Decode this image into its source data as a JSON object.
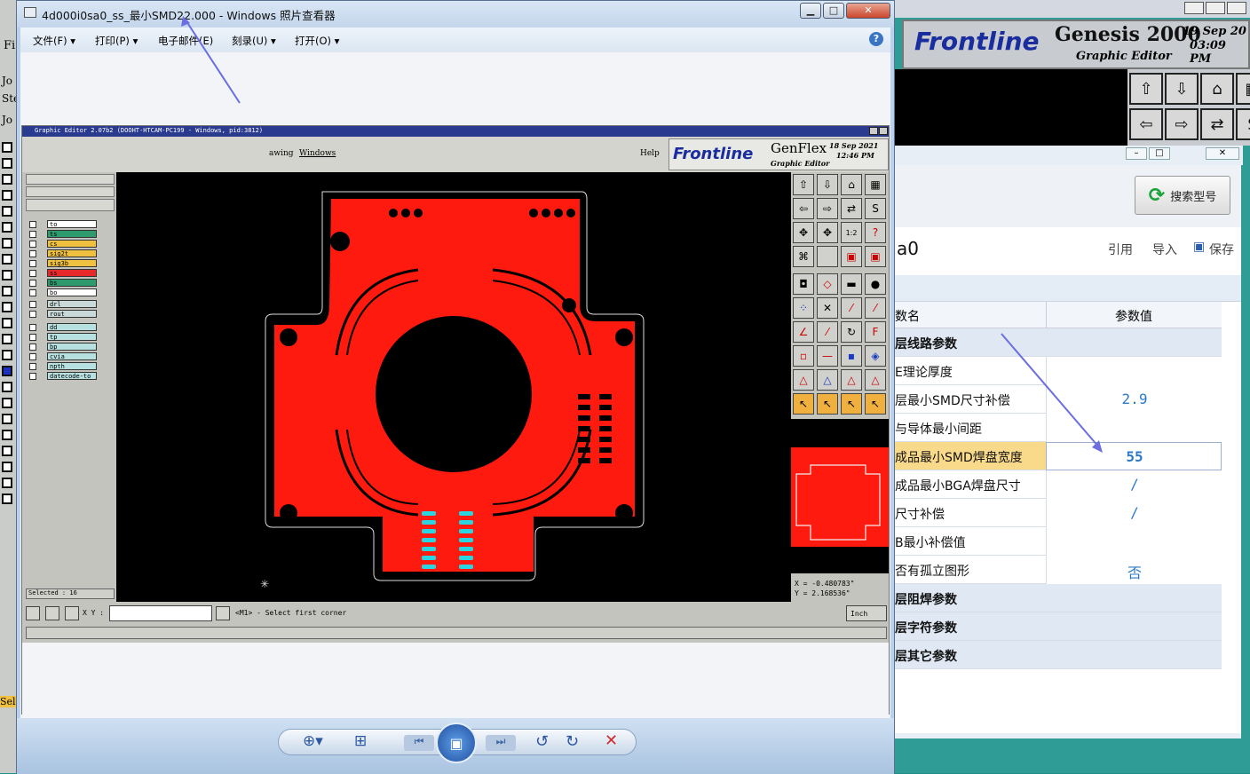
{
  "background": {
    "left_labels": [
      "Fi",
      "Jo",
      "Ste",
      "Jo",
      "Sel"
    ],
    "genesis": {
      "brand": "Frontline",
      "product": "Genesis 2000",
      "subtitle": "Graphic Editor",
      "date": "19  Sep  20",
      "time": "03:09  PM"
    }
  },
  "viewer": {
    "title": "4d000i0sa0_ss_最小SMD22.000 - Windows 照片查看器",
    "menu": [
      "文件(F)",
      "打印(P)",
      "电子邮件(E)",
      "刻录(U)",
      "打开(O)"
    ],
    "help": "?"
  },
  "editor": {
    "title": "Graphic Editor 2.07b2 (DOOHT-HTCAM-PC199 - Windows, pid:3812)",
    "menu": [
      "awing",
      "Windows"
    ],
    "help": "Help",
    "brand": "Frontline",
    "product": "GenFlex",
    "subtitle": "Graphic Editor",
    "date": "18 Sep 2021",
    "time": "12:46 PM",
    "layers": [
      {
        "name": "to",
        "color": "#ffffff"
      },
      {
        "name": "ts",
        "color": "#2f9a6d"
      },
      {
        "name": "cs",
        "color": "#f0c040"
      },
      {
        "name": "sig2t",
        "color": "#f0c040"
      },
      {
        "name": "sig3b",
        "color": "#f0c040"
      },
      {
        "name": "ss",
        "color": "#e8292b"
      },
      {
        "name": "bs",
        "color": "#2f9a6d"
      },
      {
        "name": "bo",
        "color": "#ffffff"
      },
      {
        "name": "drl",
        "color": "#c9d8d8"
      },
      {
        "name": "rout",
        "color": "#c9d8d8"
      },
      {
        "name": "dd",
        "color": "#b7e0e0"
      },
      {
        "name": "tp",
        "color": "#b7e0e0"
      },
      {
        "name": "bp",
        "color": "#b7e0e0"
      },
      {
        "name": "cvia",
        "color": "#b7e0e0"
      },
      {
        "name": "npth",
        "color": "#b7e0e0"
      },
      {
        "name": "datecode-to",
        "color": "#b7e0e0"
      }
    ],
    "selected": "Selected : 16",
    "xy_label": "X Y :",
    "status": "<M1> - Select first corner",
    "units": "Inch",
    "coord_x": "X = -0.480783\"",
    "coord_y": "Y =  2.168536\""
  },
  "panel": {
    "search_label": "搜索型号",
    "job_name": "a0",
    "actions": [
      "引用",
      "导入",
      "保存"
    ],
    "col_name": "数名",
    "col_value": "参数值",
    "rows": [
      {
        "name": "层线路参数",
        "value": "",
        "section": true
      },
      {
        "name": "E理论厚度",
        "value": "",
        "section": false
      },
      {
        "name": "层最小SMD尺寸补偿",
        "value": "2.9",
        "section": false
      },
      {
        "name": "与导体最小间距",
        "value": "",
        "section": false
      },
      {
        "name": "成品最小SMD焊盘宽度",
        "value": "55",
        "section": false,
        "highlight": true
      },
      {
        "name": "成品最小BGA焊盘尺寸",
        "value": "/",
        "section": false
      },
      {
        "name": "尺寸补偿",
        "value": "/",
        "section": false
      },
      {
        "name": "B最小补偿值",
        "value": "",
        "section": false
      },
      {
        "name": "否有孤立图形",
        "value": "否",
        "section": false
      },
      {
        "name": "层阻焊参数",
        "value": "",
        "section": true
      },
      {
        "name": "层字符参数",
        "value": "",
        "section": true
      },
      {
        "name": "层其它参数",
        "value": "",
        "section": true
      }
    ]
  },
  "colors": {
    "accent": "#2a7ac8",
    "pcb_red": "#ff1a10",
    "pad_cyan": "#2ad4e0",
    "highlight_row": "#f9d98a"
  }
}
